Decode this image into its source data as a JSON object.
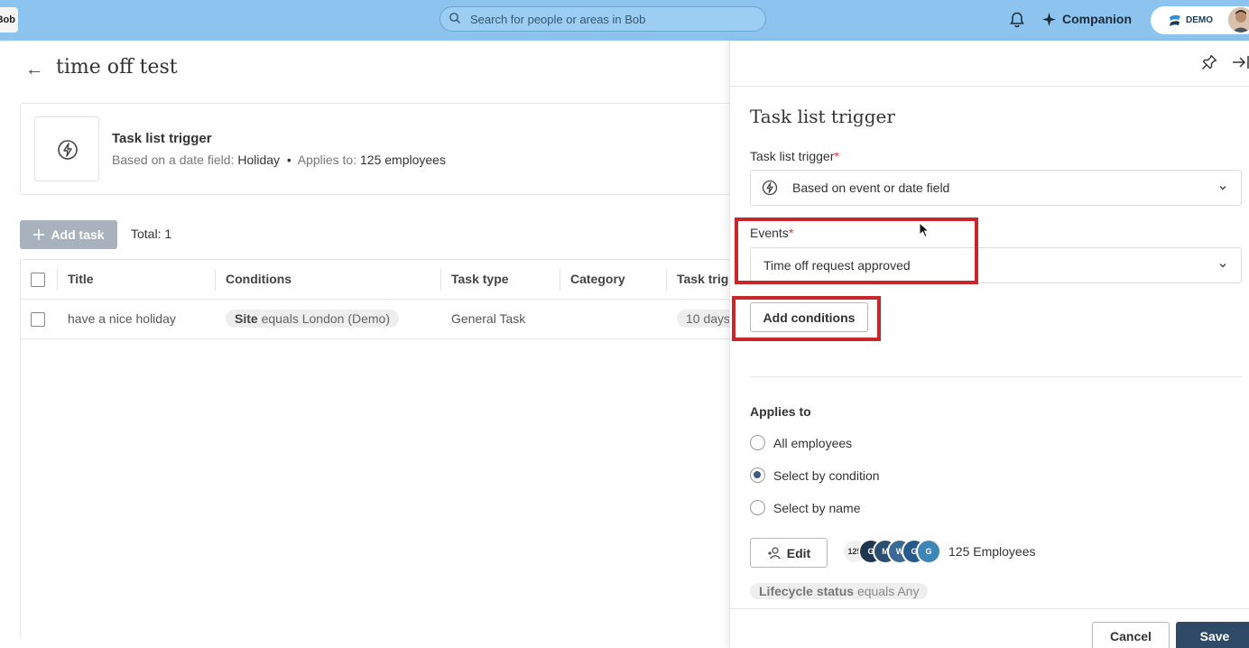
{
  "topbar": {
    "logo_text": "Bob",
    "search_placeholder": "Search for people or areas in Bob",
    "companion_label": "Companion",
    "demo_label": "DEMO"
  },
  "page": {
    "title": "time off test",
    "trigger_card": {
      "title": "Task list trigger",
      "based_on_label": "Based on a date field:",
      "based_on_value": "Holiday",
      "bullet": "•",
      "applies_label": "Applies to:",
      "applies_value": "125 employees"
    },
    "add_task_label": "Add task",
    "total_label": "Total: 1",
    "table": {
      "columns": [
        "Title",
        "Conditions",
        "Task type",
        "Category",
        "Task trig"
      ],
      "rows": [
        {
          "title": "have a nice holiday",
          "condition_field": "Site",
          "condition_rest": "equals London (Demo)",
          "task_type": "General Task",
          "category": "",
          "trigger": "10 days"
        }
      ]
    }
  },
  "panel": {
    "title": "Task list trigger",
    "trigger_label": "Task list trigger",
    "trigger_value": "Based on event or date field",
    "required_mark": "*",
    "events_label": "Events",
    "events_value": "Time off request approved",
    "add_conditions_label": "Add conditions",
    "applies_to_heading": "Applies to",
    "radio_options": [
      {
        "label": "All employees",
        "selected": false
      },
      {
        "label": "Select by condition",
        "selected": true
      },
      {
        "label": "Select by name",
        "selected": false
      }
    ],
    "edit_label": "Edit",
    "avatar_stack": [
      "125",
      "G",
      "M",
      "W",
      "G",
      "G"
    ],
    "employees_count_label": "125 Employees",
    "lifecycle_field": "Lifecycle status",
    "lifecycle_rest": "equals Any",
    "cancel_label": "Cancel",
    "save_label": "Save"
  },
  "colors": {
    "topbar": "#8cc4ef",
    "primary_button": "#2e4a66",
    "highlight_box": "#c8262a",
    "required": "#dd3333"
  }
}
